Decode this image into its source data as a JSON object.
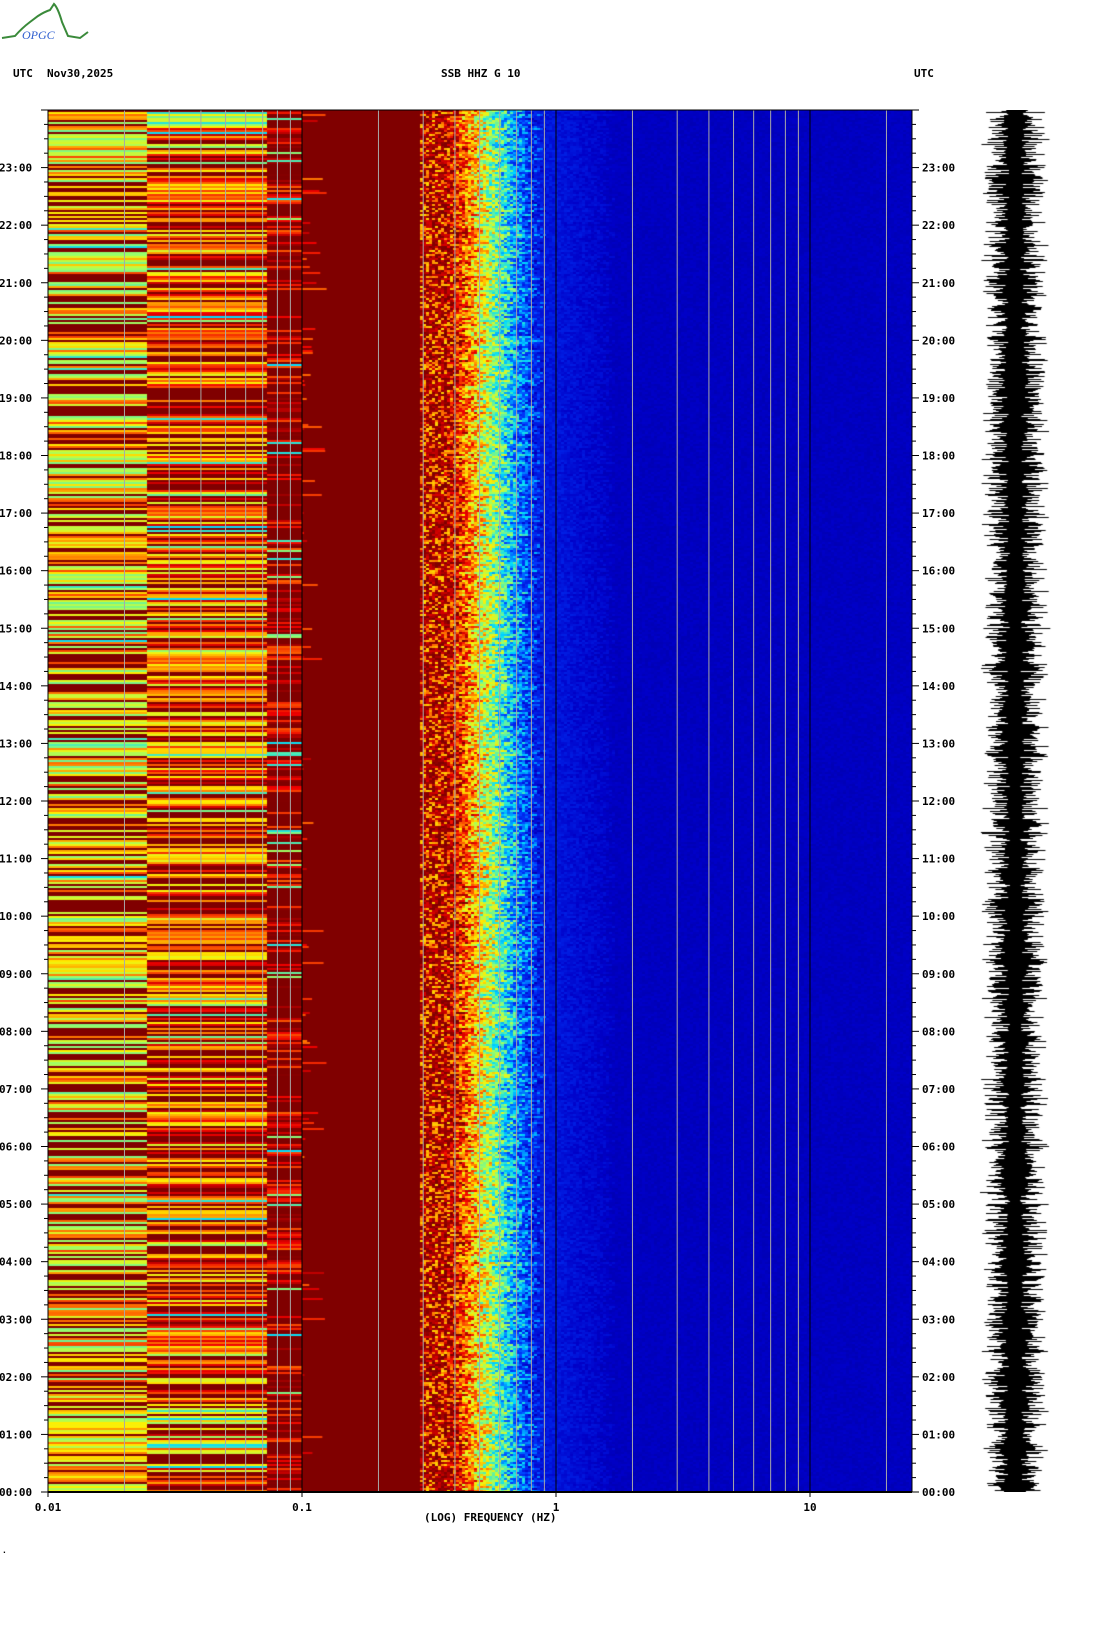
{
  "header": {
    "left_tz": "UTC",
    "date": "Nov30,2025",
    "station": "SSB HHZ G 10",
    "right_tz": "UTC"
  },
  "logo_text": "OPGC",
  "footer_mark": "·",
  "chart_data": {
    "type": "heatmap",
    "title": "SSB HHZ G 10",
    "subtitle": "UTC Nov30,2025",
    "xlabel": "(LOG) FREQUENCY (HZ)",
    "ylabel": "UTC",
    "xscale": "log",
    "xlim": [
      0.01,
      25
    ],
    "x_ticks": [
      0.01,
      0.1,
      1,
      10
    ],
    "x_tick_labels": [
      "0.01",
      "0.1",
      "1",
      "10"
    ],
    "ylim_hours": [
      0,
      24
    ],
    "y_tick_labels": [
      "00:00",
      "01:00",
      "02:00",
      "03:00",
      "04:00",
      "05:00",
      "06:00",
      "07:00",
      "08:00",
      "09:00",
      "10:00",
      "11:00",
      "12:00",
      "13:00",
      "14:00",
      "15:00",
      "16:00",
      "17:00",
      "18:00",
      "19:00",
      "20:00",
      "21:00",
      "22:00",
      "23:00"
    ],
    "colormap": "jet",
    "notes": "High power (dark red) below ~0.3 Hz, microseism peak ~0.3-0.6 Hz, low power (blue) above ~1 Hz",
    "colors": {
      "high": "#800000",
      "low": "#0000a0"
    }
  }
}
